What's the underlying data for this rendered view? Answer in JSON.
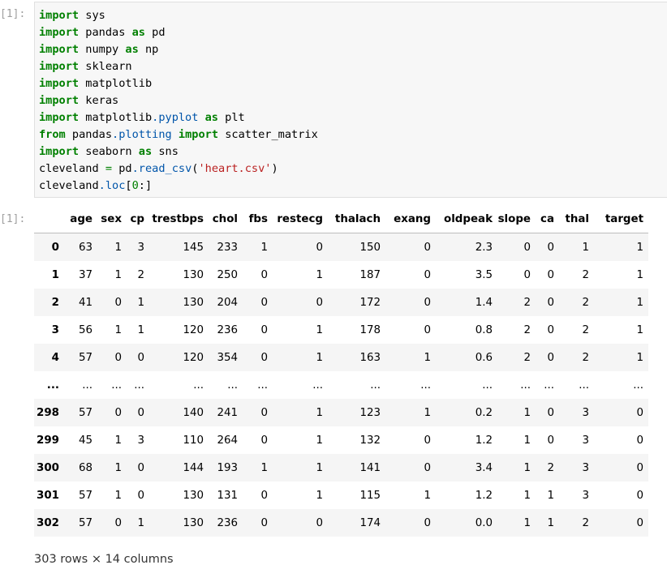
{
  "input_cell": {
    "prompt": "[1]:",
    "lines": [
      [
        {
          "t": "import",
          "c": "kw"
        },
        {
          "t": " sys",
          "c": "plain"
        }
      ],
      [
        {
          "t": "import",
          "c": "kw"
        },
        {
          "t": " pandas ",
          "c": "plain"
        },
        {
          "t": "as",
          "c": "kw"
        },
        {
          "t": " pd",
          "c": "plain"
        }
      ],
      [
        {
          "t": "import",
          "c": "kw"
        },
        {
          "t": " numpy ",
          "c": "plain"
        },
        {
          "t": "as",
          "c": "kw"
        },
        {
          "t": " np",
          "c": "plain"
        }
      ],
      [
        {
          "t": "import",
          "c": "kw"
        },
        {
          "t": " sklearn",
          "c": "plain"
        }
      ],
      [
        {
          "t": "import",
          "c": "kw"
        },
        {
          "t": " matplotlib",
          "c": "plain"
        }
      ],
      [
        {
          "t": "import",
          "c": "kw"
        },
        {
          "t": " keras",
          "c": "plain"
        }
      ],
      [
        {
          "t": "import",
          "c": "kw"
        },
        {
          "t": " matplotlib",
          "c": "plain"
        },
        {
          "t": ".pyplot",
          "c": "attr"
        },
        {
          "t": " ",
          "c": "plain"
        },
        {
          "t": "as",
          "c": "kw"
        },
        {
          "t": " plt",
          "c": "plain"
        }
      ],
      [
        {
          "t": "from",
          "c": "kw"
        },
        {
          "t": " pandas",
          "c": "plain"
        },
        {
          "t": ".plotting",
          "c": "attr"
        },
        {
          "t": " ",
          "c": "plain"
        },
        {
          "t": "import",
          "c": "kw"
        },
        {
          "t": " scatter_matrix",
          "c": "plain"
        }
      ],
      [
        {
          "t": "import",
          "c": "kw"
        },
        {
          "t": " seaborn ",
          "c": "plain"
        },
        {
          "t": "as",
          "c": "kw"
        },
        {
          "t": " sns",
          "c": "plain"
        }
      ],
      [
        {
          "t": "cleveland ",
          "c": "plain"
        },
        {
          "t": "=",
          "c": "op"
        },
        {
          "t": " pd",
          "c": "plain"
        },
        {
          "t": ".read_csv",
          "c": "attr"
        },
        {
          "t": "(",
          "c": "plain"
        },
        {
          "t": "'heart.csv'",
          "c": "str"
        },
        {
          "t": ")",
          "c": "plain"
        }
      ],
      [
        {
          "t": "cleveland",
          "c": "plain"
        },
        {
          "t": ".loc",
          "c": "attr"
        },
        {
          "t": "[",
          "c": "plain"
        },
        {
          "t": "0",
          "c": "num"
        },
        {
          "t": ":]",
          "c": "plain"
        }
      ]
    ]
  },
  "output_cell": {
    "prompt": "[1]:",
    "columns": [
      "",
      "age",
      "sex",
      "cp",
      "trestbps",
      "chol",
      "fbs",
      "restecg",
      "thalach",
      "exang",
      "oldpeak",
      "slope",
      "ca",
      "thal",
      "target"
    ],
    "rows": [
      [
        "0",
        "63",
        "1",
        "3",
        "145",
        "233",
        "1",
        "0",
        "150",
        "0",
        "2.3",
        "0",
        "0",
        "1",
        "1"
      ],
      [
        "1",
        "37",
        "1",
        "2",
        "130",
        "250",
        "0",
        "1",
        "187",
        "0",
        "3.5",
        "0",
        "0",
        "2",
        "1"
      ],
      [
        "2",
        "41",
        "0",
        "1",
        "130",
        "204",
        "0",
        "0",
        "172",
        "0",
        "1.4",
        "2",
        "0",
        "2",
        "1"
      ],
      [
        "3",
        "56",
        "1",
        "1",
        "120",
        "236",
        "0",
        "1",
        "178",
        "0",
        "0.8",
        "2",
        "0",
        "2",
        "1"
      ],
      [
        "4",
        "57",
        "0",
        "0",
        "120",
        "354",
        "0",
        "1",
        "163",
        "1",
        "0.6",
        "2",
        "0",
        "2",
        "1"
      ],
      [
        "...",
        "...",
        "...",
        "...",
        "...",
        "...",
        "...",
        "...",
        "...",
        "...",
        "...",
        "...",
        "...",
        "...",
        "..."
      ],
      [
        "298",
        "57",
        "0",
        "0",
        "140",
        "241",
        "0",
        "1",
        "123",
        "1",
        "0.2",
        "1",
        "0",
        "3",
        "0"
      ],
      [
        "299",
        "45",
        "1",
        "3",
        "110",
        "264",
        "0",
        "1",
        "132",
        "0",
        "1.2",
        "1",
        "0",
        "3",
        "0"
      ],
      [
        "300",
        "68",
        "1",
        "0",
        "144",
        "193",
        "1",
        "1",
        "141",
        "0",
        "3.4",
        "1",
        "2",
        "3",
        "0"
      ],
      [
        "301",
        "57",
        "1",
        "0",
        "130",
        "131",
        "0",
        "1",
        "115",
        "1",
        "1.2",
        "1",
        "1",
        "3",
        "0"
      ],
      [
        "302",
        "57",
        "0",
        "1",
        "130",
        "236",
        "0",
        "0",
        "174",
        "0",
        "0.0",
        "1",
        "1",
        "2",
        "0"
      ]
    ],
    "summary": "303 rows × 14 columns"
  }
}
